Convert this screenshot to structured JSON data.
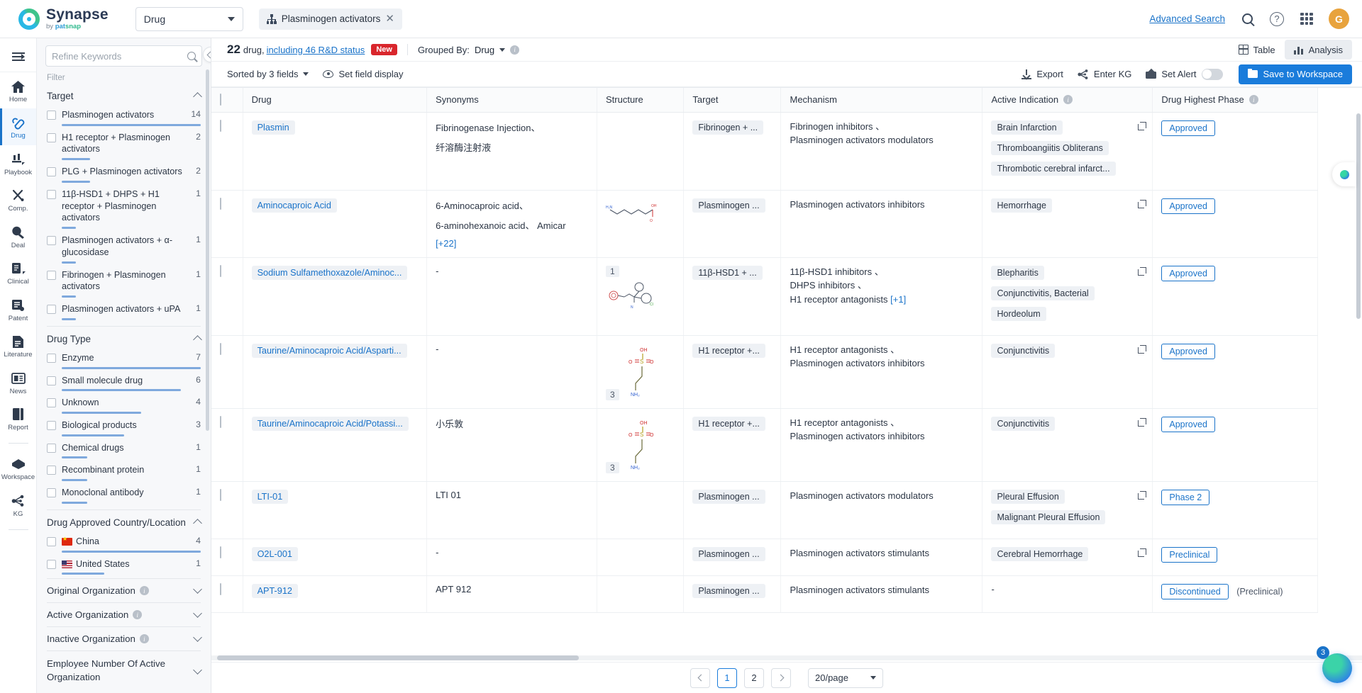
{
  "topbar": {
    "brand_name": "Synapse",
    "brand_sub_by": "by ",
    "brand_sub_pat": "pat",
    "brand_sub_snap": "snap",
    "entity_select": "Drug",
    "chip_label": "Plasminogen activators",
    "chip_close": "✕",
    "advanced_search": "Advanced Search",
    "help": "?",
    "avatar_initial": "G"
  },
  "rail": {
    "collapse_name": "collapse-rail",
    "items": [
      {
        "label": "Home",
        "icon": "home-icon"
      },
      {
        "label": "Drug",
        "icon": "capsule-icon"
      },
      {
        "label": "Playbook",
        "icon": "playbook-icon"
      },
      {
        "label": "Comp.",
        "icon": "competitor-icon"
      },
      {
        "label": "Deal",
        "icon": "deal-icon"
      },
      {
        "label": "Clinical",
        "icon": "clinical-icon"
      },
      {
        "label": "Patent",
        "icon": "patent-icon"
      },
      {
        "label": "Literature",
        "icon": "literature-icon"
      },
      {
        "label": "News",
        "icon": "news-icon"
      },
      {
        "label": "Report",
        "icon": "report-icon"
      },
      {
        "label": "Workspace",
        "icon": "workspace-icon"
      },
      {
        "label": "KG",
        "icon": "kg-icon"
      }
    ]
  },
  "filters": {
    "refine_placeholder": "Refine Keywords",
    "filter_label": "Filter",
    "groups": [
      {
        "title": "Target",
        "items": [
          {
            "name": "Plasminogen activators",
            "count": "14",
            "bar": 100
          },
          {
            "name": "H1 receptor + Plasminogen activators",
            "count": "2",
            "bar": 14
          },
          {
            "name": "PLG + Plasminogen activators",
            "count": "2",
            "bar": 14
          },
          {
            "name": "11β-HSD1 + DHPS + H1 receptor + Plasminogen activators",
            "count": "1",
            "bar": 7
          },
          {
            "name": "Plasminogen activators + α-glucosidase",
            "count": "1",
            "bar": 7
          },
          {
            "name": "Fibrinogen + Plasminogen activators",
            "count": "1",
            "bar": 7
          },
          {
            "name": "Plasminogen activators + uPA",
            "count": "1",
            "bar": 7
          }
        ]
      },
      {
        "title": "Drug Type",
        "items": [
          {
            "name": "Enzyme",
            "count": "7",
            "bar": 100
          },
          {
            "name": "Small molecule drug",
            "count": "6",
            "bar": 86
          },
          {
            "name": "Unknown",
            "count": "4",
            "bar": 57
          },
          {
            "name": "Biological products",
            "count": "3",
            "bar": 43
          },
          {
            "name": "Chemical drugs",
            "count": "1",
            "bar": 14
          },
          {
            "name": "Recombinant protein",
            "count": "1",
            "bar": 14
          },
          {
            "name": "Monoclonal antibody",
            "count": "1",
            "bar": 14
          }
        ]
      },
      {
        "title": "Drug Approved Country/Location",
        "items": [
          {
            "name": "China",
            "count": "4",
            "bar": 100,
            "flag": "cn"
          },
          {
            "name": "United States",
            "count": "1",
            "bar": 25,
            "flag": "us"
          }
        ]
      }
    ],
    "simple_groups": [
      {
        "title": "Original Organization",
        "info": true
      },
      {
        "title": "Active Organization",
        "info": true
      },
      {
        "title": "Inactive Organization",
        "info": true
      },
      {
        "title": "Employee Number Of Active Organization",
        "info": false
      }
    ]
  },
  "results": {
    "count": "22",
    "count_suffix": "drug,",
    "link": "including 46 R&D status",
    "badge": "New",
    "grouped_by_label": "Grouped By:",
    "grouped_by_value": "Drug",
    "view_table": "Table",
    "view_analysis": "Analysis"
  },
  "toolbar": {
    "sorted_by": "Sorted by 3 fields",
    "set_field_display": "Set field display",
    "export": "Export",
    "enter_kg": "Enter KG",
    "set_alert": "Set Alert",
    "save_to_workspace": "Save to Workspace"
  },
  "table": {
    "columns": [
      "Drug",
      "Synonyms",
      "Structure",
      "Target",
      "Mechanism",
      "Active Indication",
      "Drug Highest Phase"
    ],
    "rows": [
      {
        "drug": "Plasmin",
        "synonyms": [
          "Fibrinogenase Injection、"
        ],
        "synonyms_zh": "纤溶酶注射液",
        "synonyms_more": "",
        "structure_badge": "",
        "target": "Fibrinogen + ...",
        "mechanism": [
          "Fibrinogen inhibitors 、",
          "Plasminogen activators modulators"
        ],
        "mechanism_more": "",
        "indications": [
          "Brain Infarction",
          "Thromboangiitis Obliterans",
          "Thrombotic cerebral infarct..."
        ],
        "phase": "Approved",
        "phase_note": ""
      },
      {
        "drug": "Aminocaproic Acid",
        "synonyms": [
          "6-Aminocaproic acid、",
          "6-aminohexanoic acid、 Amicar"
        ],
        "synonyms_zh": "",
        "synonyms_more": "[+22]",
        "structure_badge": "",
        "target": "Plasminogen ...",
        "mechanism": [
          "Plasminogen activators inhibitors"
        ],
        "mechanism_more": "",
        "indications": [
          "Hemorrhage"
        ],
        "phase": "Approved",
        "phase_note": ""
      },
      {
        "drug": "Sodium Sulfamethoxazole/Aminoc...",
        "synonyms": [
          "-"
        ],
        "synonyms_zh": "",
        "synonyms_more": "",
        "structure_badge": "1",
        "target": "11β-HSD1 + ...",
        "mechanism": [
          "11β-HSD1 inhibitors 、",
          "DHPS inhibitors 、",
          "H1 receptor antagonists"
        ],
        "mechanism_more": "[+1]",
        "indications": [
          "Blepharitis",
          "Conjunctivitis, Bacterial",
          "Hordeolum"
        ],
        "phase": "Approved",
        "phase_note": ""
      },
      {
        "drug": "Taurine/Aminocaproic Acid/Asparti...",
        "synonyms": [
          "-"
        ],
        "synonyms_zh": "",
        "synonyms_more": "",
        "structure_badge": "3",
        "target": "H1 receptor +...",
        "mechanism": [
          "H1 receptor antagonists 、",
          "Plasminogen activators inhibitors"
        ],
        "mechanism_more": "",
        "indications": [
          "Conjunctivitis"
        ],
        "phase": "Approved",
        "phase_note": ""
      },
      {
        "drug": "Taurine/Aminocaproic Acid/Potassi...",
        "synonyms": [
          "小乐敦"
        ],
        "synonyms_zh": "",
        "synonyms_more": "",
        "structure_badge": "3",
        "target": "H1 receptor +...",
        "mechanism": [
          "H1 receptor antagonists 、",
          "Plasminogen activators inhibitors"
        ],
        "mechanism_more": "",
        "indications": [
          "Conjunctivitis"
        ],
        "phase": "Approved",
        "phase_note": ""
      },
      {
        "drug": "LTI-01",
        "synonyms": [
          "LTI 01"
        ],
        "synonyms_zh": "",
        "synonyms_more": "",
        "structure_badge": "",
        "target": "Plasminogen ...",
        "mechanism": [
          "Plasminogen activators modulators"
        ],
        "mechanism_more": "",
        "indications": [
          "Pleural Effusion",
          "Malignant Pleural Effusion"
        ],
        "phase": "Phase 2",
        "phase_note": ""
      },
      {
        "drug": "O2L-001",
        "synonyms": [
          "-"
        ],
        "synonyms_zh": "",
        "synonyms_more": "",
        "structure_badge": "",
        "target": "Plasminogen ...",
        "mechanism": [
          "Plasminogen activators stimulants"
        ],
        "mechanism_more": "",
        "indications": [
          "Cerebral Hemorrhage"
        ],
        "phase": "Preclinical",
        "phase_note": ""
      },
      {
        "drug": "APT-912",
        "synonyms": [
          "APT 912"
        ],
        "synonyms_zh": "",
        "synonyms_more": "",
        "structure_badge": "",
        "target": "Plasminogen ...",
        "mechanism": [
          "Plasminogen activators stimulants"
        ],
        "mechanism_more": "",
        "indications": [
          "-"
        ],
        "phase": "Discontinued",
        "phase_note": "(Preclinical)"
      }
    ]
  },
  "pagination": {
    "prev": "‹",
    "pages": [
      "1",
      "2"
    ],
    "next": "›",
    "page_size": "20/page"
  },
  "floating": {
    "badge_count": "3"
  }
}
